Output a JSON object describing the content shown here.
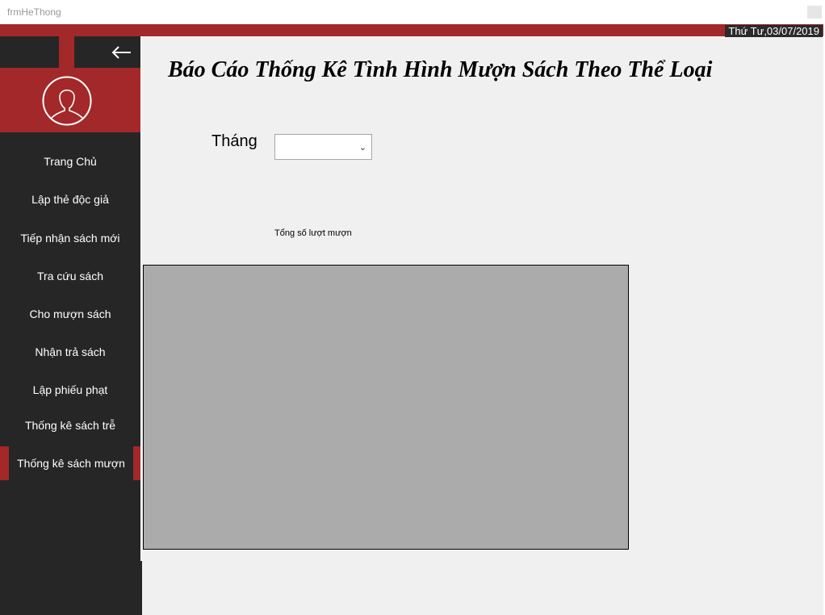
{
  "window": {
    "title": "frmHeThong"
  },
  "header": {
    "date": "Thứ Tư,03/07/2019"
  },
  "sidebar": {
    "back_icon": "arrow-left-icon",
    "avatar_icon": "user-avatar-icon",
    "items": [
      {
        "label": "Trang Chủ"
      },
      {
        "label": "Lập thẻ độc giả"
      },
      {
        "label": "Tiếp nhận sách mới"
      },
      {
        "label": "Tra cứu sách"
      },
      {
        "label": "Cho  mượn sách"
      },
      {
        "label": "Nhận trả sách"
      },
      {
        "label": "Lập phiếu phạt"
      },
      {
        "label": "Thống kê sách trễ"
      },
      {
        "label": "Thống kê sách mượn",
        "active": true
      }
    ]
  },
  "main": {
    "title": "Báo Cáo Thống Kê Tình Hình Mượn Sách Theo Thể Loại",
    "month_label": "Tháng",
    "month_value": "",
    "total_label": "Tổng số lượt mượn"
  },
  "colors": {
    "accent": "#a3282a",
    "sidebar_bg": "#262626",
    "chart_bg": "#ababab"
  }
}
